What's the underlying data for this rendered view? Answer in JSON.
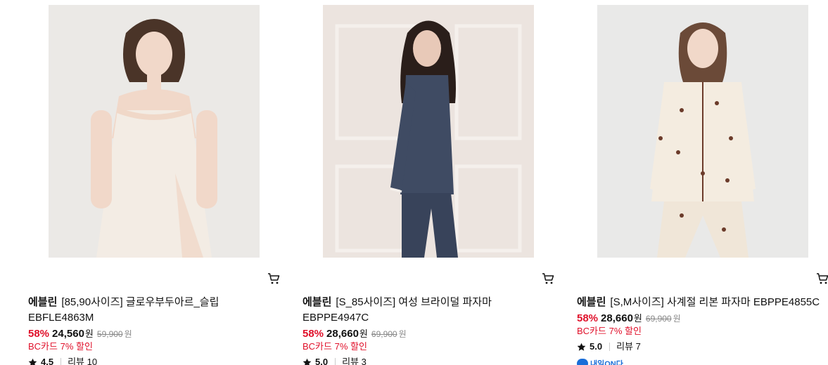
{
  "products": [
    {
      "brand": "에블린",
      "name_line1": "[85,90사이즈] 글로우부두아르_슬립",
      "name_line2": "EBFLE4863M",
      "discount_rate": "58%",
      "price": "24,560",
      "currency": "원",
      "original_price": "59,900",
      "original_currency": "원",
      "card_discount": "BC카드 7% 할인",
      "rating": "4.5",
      "review_label": "리뷰 10",
      "colors": {
        "bg": "#ebe9e6",
        "garment": "#f3ece4",
        "lace": "#f0d8c8"
      }
    },
    {
      "brand": "에블린",
      "name_line1": "[S_85사이즈] 여성 브라이덜 파자마",
      "name_line2": "EBPPE4947C",
      "discount_rate": "58%",
      "price": "28,660",
      "currency": "원",
      "original_price": "69,900",
      "original_currency": "원",
      "card_discount": "BC카드 7% 할인",
      "rating": "5.0",
      "review_label": "리뷰 3",
      "colors": {
        "bg": "#ece4df",
        "garment": "#3f4b63",
        "lace": "#f5f0ec"
      }
    },
    {
      "brand": "에블린",
      "name_line1": "[S,M사이즈] 사계절 리본 파자마 EBPPE4855C",
      "name_line2": "",
      "discount_rate": "58%",
      "price": "28,660",
      "currency": "원",
      "original_price": "69,900",
      "original_currency": "원",
      "card_discount": "BC카드 7% 할인",
      "rating": "5.0",
      "review_label": "리뷰 7",
      "badge_label": "내일ON다",
      "colors": {
        "bg": "#e9e9e8",
        "garment": "#f4ece0",
        "lace": "#6b3b2a"
      }
    }
  ],
  "icons": {
    "cart": "cart-icon",
    "star": "star-icon"
  },
  "accent_color": "#e0102a"
}
